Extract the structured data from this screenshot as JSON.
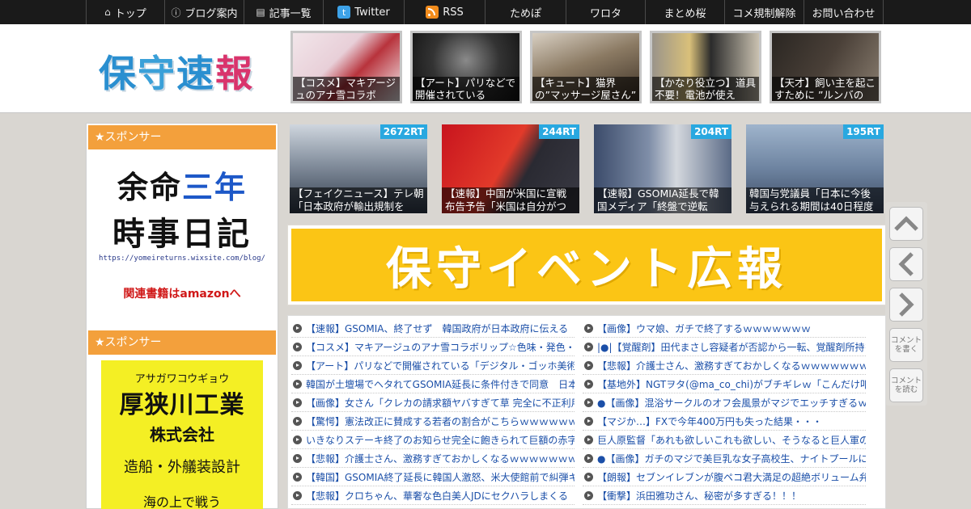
{
  "nav": {
    "items": [
      {
        "label": "トップ",
        "icon": "home-icon"
      },
      {
        "label": "ブログ案内",
        "icon": "info-icon"
      },
      {
        "label": "記事一覧",
        "icon": "list-icon"
      },
      {
        "label": "Twitter",
        "icon": "twitter-icon"
      },
      {
        "label": "RSS",
        "icon": "rss-icon"
      },
      {
        "label": "ためぽ",
        "icon": ""
      },
      {
        "label": "ワロタ",
        "icon": ""
      },
      {
        "label": "まとめ桜",
        "icon": ""
      },
      {
        "label": "コメ規制解除",
        "icon": ""
      },
      {
        "label": "お問い合わせ",
        "icon": ""
      }
    ]
  },
  "header": {
    "logo": [
      "保",
      "守",
      "速",
      "報"
    ],
    "thumbs": [
      {
        "caption": "【コスメ】マキアージュのアナ雪コラボ"
      },
      {
        "caption": "【アート】パリなどで開催されている"
      },
      {
        "caption": "【キュート】猫界の”マッサージ屋さん”"
      },
      {
        "caption": "【かなり役立つ】道具不要！電池が使え"
      },
      {
        "caption": "【天才】飼い主を起こすために ”ルンバの"
      }
    ]
  },
  "sidebar": {
    "sponsor1": "★スポンサー",
    "ad1": {
      "line1a": "余命",
      "line1b": "三年",
      "line2": "時事日記",
      "url": "https://yomeireturns.wixsite.com/blog/",
      "amazon": "関連書籍はamazonへ"
    },
    "sponsor2": "★スポンサー",
    "ad2": {
      "kana": "アサガワコウギョウ",
      "name": "厚狭川工業",
      "corp": "株式会社",
      "service": "造船・外艤装設計",
      "tagline": "海の上で戦う"
    }
  },
  "ranking": [
    {
      "rt": "2672RT",
      "caption": "【フェイクニュース】テレ朝「日本政府が輸出規制を"
    },
    {
      "rt": "244RT",
      "caption": "【速報】中国が米国に宣戦布告予告「米国は自分がつ"
    },
    {
      "rt": "204RT",
      "caption": "【速報】GSOMIA延長で韓国メディア「終盤で逆転"
    },
    {
      "rt": "195RT",
      "caption": "韓国与党議員「日本に今後与えられる期間は40日程度"
    }
  ],
  "banner": {
    "text": "保守イベント広報"
  },
  "controls": {
    "comment_write": "コメントを書く",
    "comment_read": "コメントを読む"
  },
  "links": {
    "left": [
      "【速報】GSOMIA、終了せず　韓国政府が日本政府に伝える",
      "【コスメ】マキアージュのアナ雪コラボリップ☆色味・発色・",
      "【アート】パリなどで開催されている「デジタル・ゴッホ美術",
      "韓国が土壇場でヘタれてGSOMIA延長に条件付きで同意　日本",
      "【画像】女さん「クレカの請求額ヤバすぎて草 完全に不正利用",
      "【驚愕】憲法改正に賛成する若者の割合がこちらｗｗｗｗｗｗ",
      "いきなりステーキ終了のお知らせ完全に飽きられて巨額の赤字",
      "【悲報】介護士さん、激務すぎておかしくなるｗｗｗｗｗｗｗ",
      "【韓国】GSOMIA終了延長に韓国人激怒、米大使館前で糾弾キ",
      "【悲報】クロちゃん、華奢な色白美人JDにセクハラしまくる"
    ],
    "right": [
      "【画像】ウマ娘、ガチで終了するｗｗｗｗｗｗｗ",
      "|●|【覚醒剤】田代まさし容疑者が否認から一転、覚醒剤所持を",
      "【悲報】介護士さん、激務すぎておかしくなるｗｗｗｗｗｗｗ",
      "【基地外】NGTヲタ(@ma_co_chi)がブチギレｗ「こんだけ叩か",
      "●【画像】混浴サークルのオフ会風景がマジでエッチすぎるｗｗ",
      "【マジか…】FXで今年400万円も失った結果・・・",
      "巨人原監督「あれも欲しいこれも欲しい、そうなると巨人軍の",
      "●【画像】ガチのマジで美巨乳な女子高校生、ナイトプールに行",
      "【朗報】セブンイレブンが腹ペコ君大満足の超絶ボリューム弁",
      "【衝撃】浜田雅功さん、秘密が多すぎる！！！"
    ]
  }
}
